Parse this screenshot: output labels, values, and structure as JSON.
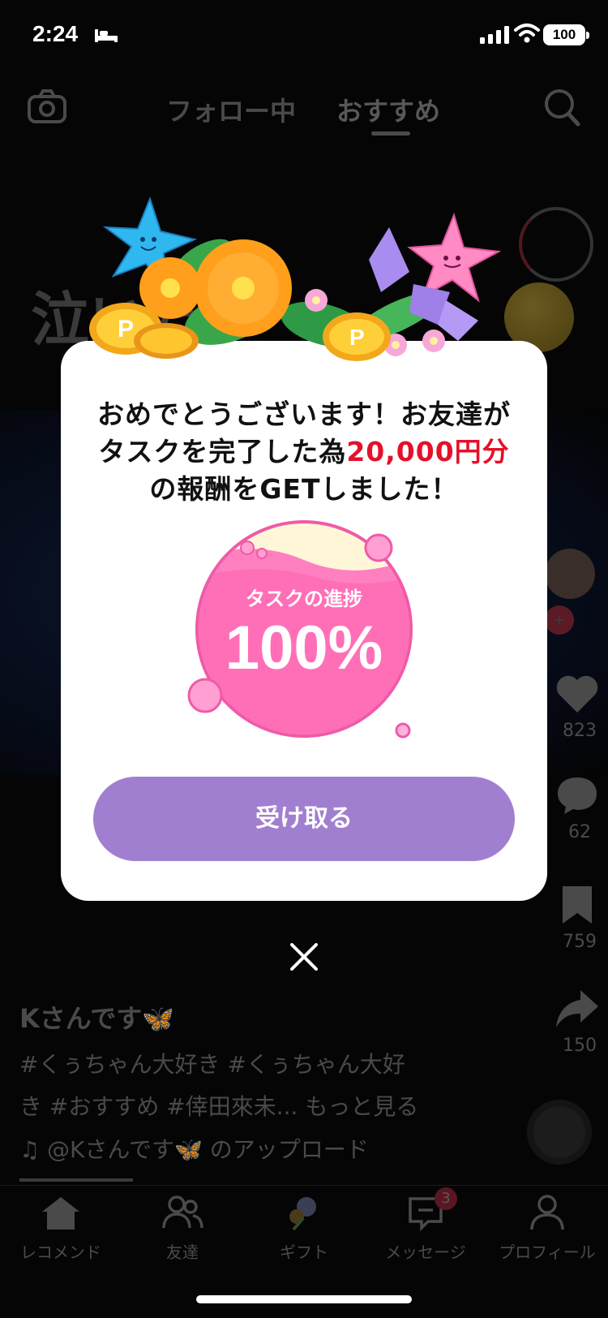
{
  "status_bar": {
    "time": "2:24",
    "battery": "100"
  },
  "header": {
    "tabs": [
      {
        "label": "フォロー中"
      },
      {
        "label": "おすすめ"
      }
    ]
  },
  "video": {
    "overlay_title": "泣いた",
    "like_count": "823",
    "comment_count": "62",
    "bookmark_count": "759",
    "share_count": "150",
    "author": "Kさんです🦋",
    "caption_line1": "#くぅちゃん大好き #くぅちゃん大好",
    "caption_line2": "き #おすすめ #倖田來未... もっと見る",
    "sound": "♫ @Kさんです🦋 のアップロード"
  },
  "bottom_nav": {
    "items": [
      {
        "label": "レコメンド"
      },
      {
        "label": "友達"
      },
      {
        "label": "ギフト"
      },
      {
        "label": "メッセージ"
      },
      {
        "label": "プロフィール"
      }
    ],
    "message_badge": "3"
  },
  "modal": {
    "headline_part1": "おめでとうございます！お友達がタスクを完了した為",
    "headline_amount": "20,000円分",
    "headline_part2": "の報酬をGETしました！",
    "progress_label": "タスクの進捗",
    "progress_value": "100%",
    "progress_fraction": 1.0,
    "button_label": "受け取る",
    "accent_color": "#a17fd0",
    "amount_color": "#e5102a"
  }
}
